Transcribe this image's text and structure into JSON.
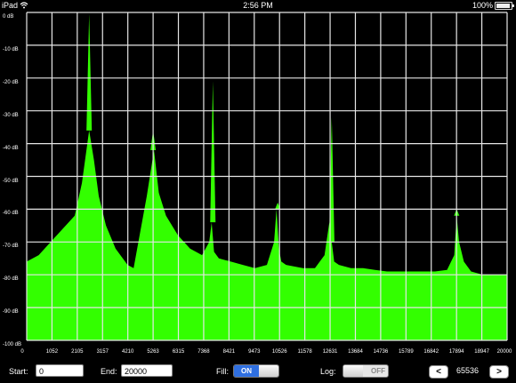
{
  "status_bar": {
    "carrier": "iPad",
    "time": "2:56 PM",
    "battery": "100%",
    "wifi_icon": "wifi-icon",
    "battery_icon": "battery-icon"
  },
  "colors": {
    "spectrum_fill": "#33ff00",
    "grid": "#e6e6e6",
    "background": "#000000",
    "switch_on": "#2f6fe0"
  },
  "chart_data": {
    "type": "area",
    "title": "",
    "xlabel": "",
    "ylabel": "",
    "y_unit_labels": [
      "0 dB",
      "-10 dB",
      "-20 dB",
      "-30 dB",
      "-40 dB",
      "-50 dB",
      "-60 dB",
      "-70 dB",
      "-80 dB",
      "-90 dB",
      "-100 dB"
    ],
    "x_tick_labels": [
      "0",
      "1052",
      "2105",
      "3157",
      "4210",
      "5263",
      "6315",
      "7368",
      "8421",
      "9473",
      "10526",
      "11578",
      "12631",
      "13684",
      "14736",
      "15789",
      "16842",
      "17894",
      "18947",
      "20000"
    ],
    "xlim": [
      0,
      20000
    ],
    "ylim": [
      -100,
      0
    ],
    "grid": true,
    "series": [
      {
        "x": [
          0,
          500,
          1000,
          1500,
          2000,
          2300,
          2600,
          2800,
          3000,
          3300,
          3700,
          4200,
          4450,
          4600,
          4800,
          5000,
          5300,
          5500,
          5800,
          6300,
          6800,
          7300,
          7600,
          7700,
          7800,
          8000,
          8500,
          9000,
          9500,
          10000,
          10300,
          10400,
          10500,
          10600,
          10800,
          11500,
          12000,
          12400,
          12600,
          12700,
          12800,
          13000,
          13500,
          14000,
          14500,
          15000,
          15500,
          16000,
          16500,
          17000,
          17500,
          17800,
          17900,
          18000,
          18200,
          18500,
          19000,
          19500,
          20000
        ],
        "values": [
          -76,
          -74,
          -70,
          -66,
          -62,
          -52,
          -36,
          -45,
          -56,
          -65,
          -72,
          -77,
          -78,
          -72,
          -64,
          -56,
          -42,
          -55,
          -62,
          -68,
          -72,
          -74,
          -70,
          -64,
          -73,
          -75,
          -76,
          -77,
          -78,
          -77,
          -70,
          -60,
          -72,
          -76,
          -77,
          -78,
          -78,
          -74,
          -64,
          -70,
          -76,
          -77,
          -78,
          -78,
          -78.5,
          -79,
          -79,
          -79,
          -79,
          -79,
          -78.5,
          -74,
          -62,
          -70,
          -76,
          -79,
          -80,
          -80,
          -80
        ]
      }
    ],
    "peaks": [
      {
        "x": 2600,
        "y": -0.4
      },
      {
        "x": 5263,
        "y": -36
      },
      {
        "x": 7750,
        "y": -21
      },
      {
        "x": 10450,
        "y": -58
      },
      {
        "x": 12700,
        "y": -32
      },
      {
        "x": 17900,
        "y": -60
      }
    ]
  },
  "controls": {
    "start_label": "Start:",
    "start_value": "0",
    "end_label": "End:",
    "end_value": "20000",
    "fill_label": "Fill:",
    "fill_state": "ON",
    "log_label": "Log:",
    "log_state": "OFF",
    "prev_label": "<",
    "next_label": ">",
    "fft_size": "65536"
  }
}
